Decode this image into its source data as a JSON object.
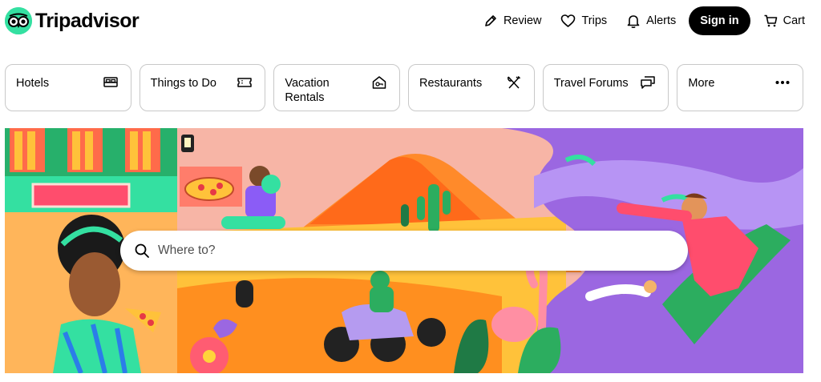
{
  "brand": {
    "name": "Tripadvisor",
    "color": "#34e0a1"
  },
  "nav": {
    "items": [
      {
        "label": "Review",
        "icon": "pencil-icon"
      },
      {
        "label": "Trips",
        "icon": "heart-icon"
      },
      {
        "label": "Alerts",
        "icon": "bell-icon"
      }
    ],
    "signin_label": "Sign in",
    "cart_label": "Cart",
    "cart_icon": "cart-icon"
  },
  "categories": [
    {
      "label": "Hotels",
      "icon": "bed-icon"
    },
    {
      "label": "Things to Do",
      "icon": "ticket-icon"
    },
    {
      "label": "Vacation Rentals",
      "icon": "house-icon"
    },
    {
      "label": "Restaurants",
      "icon": "utensils-icon"
    },
    {
      "label": "Travel Forums",
      "icon": "chat-bubbles-icon"
    },
    {
      "label": "More",
      "icon": "more-dots-icon"
    }
  ],
  "search": {
    "placeholder": "Where to?",
    "value": "",
    "icon": "search-icon"
  },
  "hero": {
    "description_colors": [
      "#f7b5a6",
      "#ffb000",
      "#9b67e1",
      "#34e0a1",
      "#ff5c5c"
    ]
  }
}
